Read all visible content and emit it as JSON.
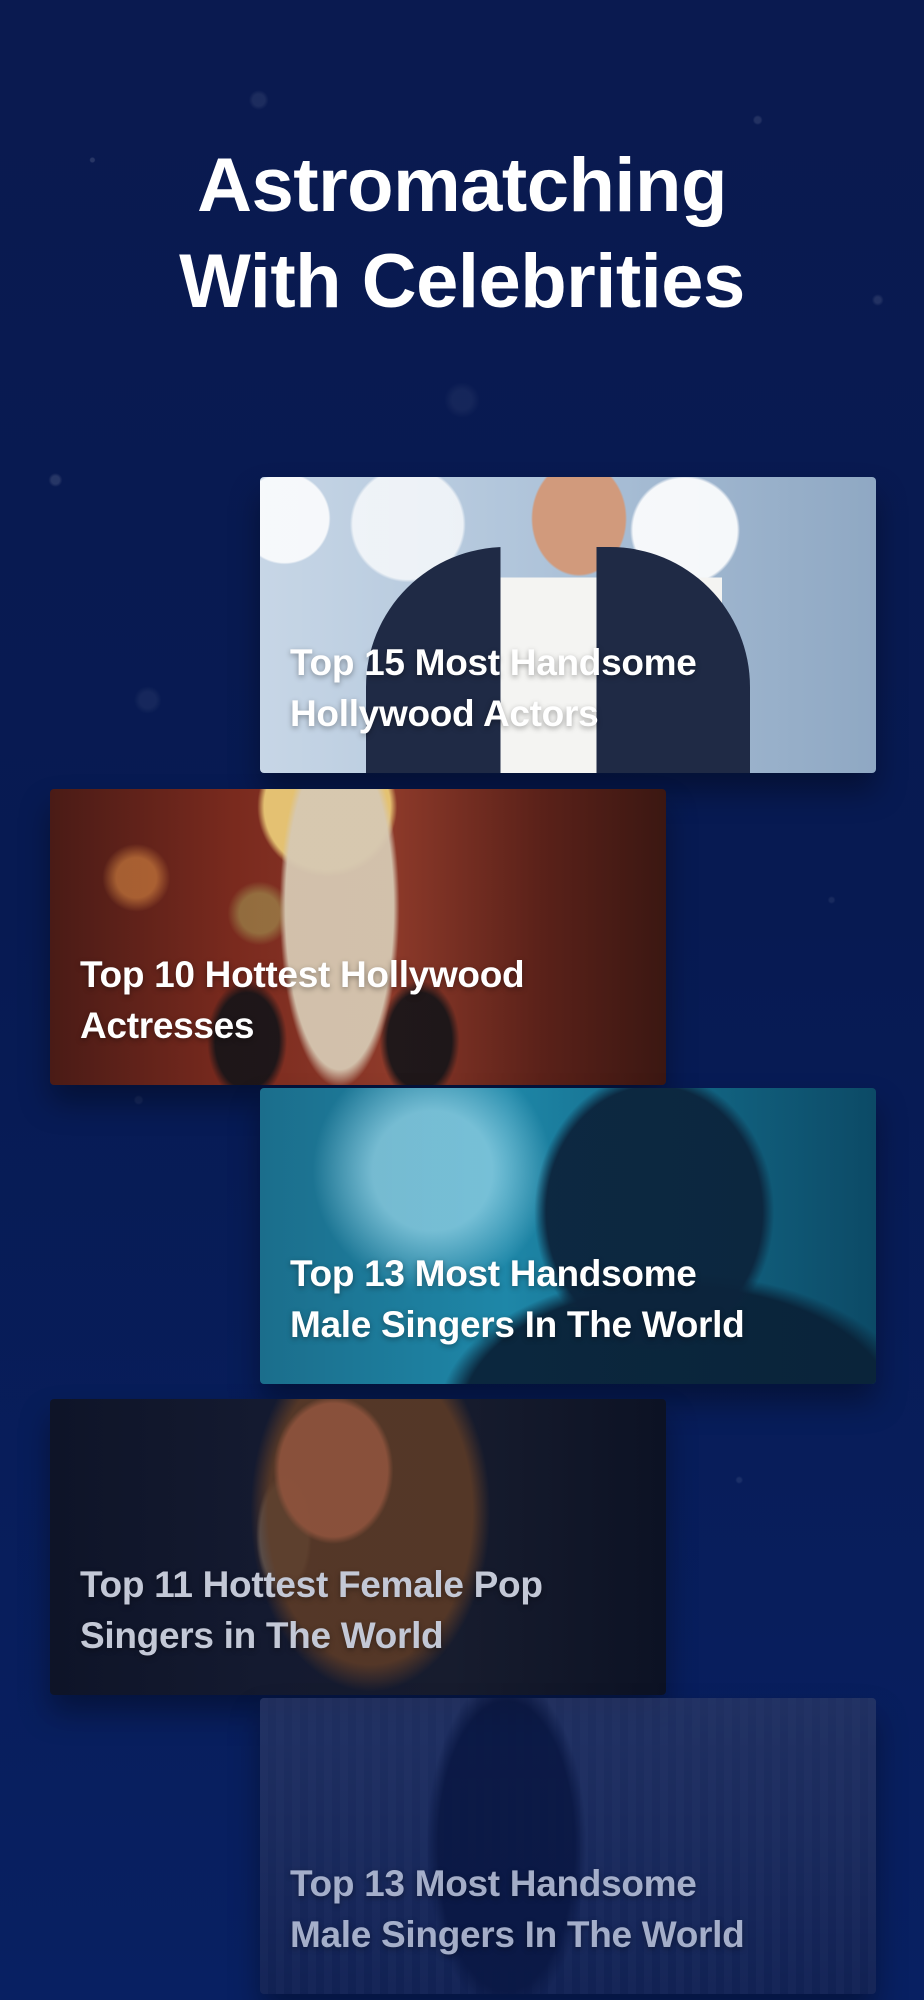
{
  "header": {
    "title_line1": "Astromatching",
    "title_line2": "With Celebrities"
  },
  "cards": [
    {
      "line1": "Top 15 Most Handsome",
      "line2": "Hollywood Actors"
    },
    {
      "line1": "Top 10 Hottest Hollywood",
      "line2": "Actresses"
    },
    {
      "line1": "Top 13  Most Handsome",
      "line2": "Male Singers In The World"
    },
    {
      "line1": "Top 11  Hottest Female Pop",
      "line2": "Singers in The World"
    },
    {
      "line1": "Top 13  Most Handsome",
      "line2": "Male Singers In The World"
    }
  ],
  "colors": {
    "background": "#071A52",
    "title_text": "#FFFFFF",
    "card_text": "#FFFFFF"
  }
}
